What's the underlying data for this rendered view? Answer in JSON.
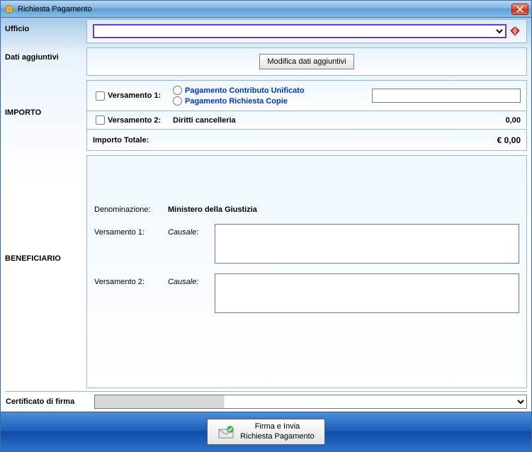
{
  "window": {
    "title": "Richiesta Pagamento"
  },
  "ufficio": {
    "label": "Ufficio",
    "value": ""
  },
  "dati": {
    "label": "Dati aggiuntivi",
    "button": "Modifica dati aggiuntivi"
  },
  "importo": {
    "label": "IMPORTO",
    "v1": {
      "label": "Versamento 1:",
      "opt1": "Pagamento Contributo Unificato",
      "opt2": "Pagamento Richiesta Copie",
      "value": ""
    },
    "v2": {
      "label": "Versamento 2:",
      "desc": "Diritti cancelleria",
      "amount": "0,00"
    },
    "totale": {
      "label": "Importo Totale:",
      "amount": "€ 0,00"
    }
  },
  "beneficiario": {
    "label": "BENEFICIARIO",
    "denom_label": "Denominazione:",
    "denom_value": "Ministero della Giustizia",
    "v1_label": "Versamento 1:",
    "v2_label": "Versamento 2:",
    "causale_label": "Causale:"
  },
  "cert": {
    "label": "Certificato di firma",
    "value": ""
  },
  "footer": {
    "line1": "Firma e Invia",
    "line2": "Richiesta Pagamento"
  }
}
